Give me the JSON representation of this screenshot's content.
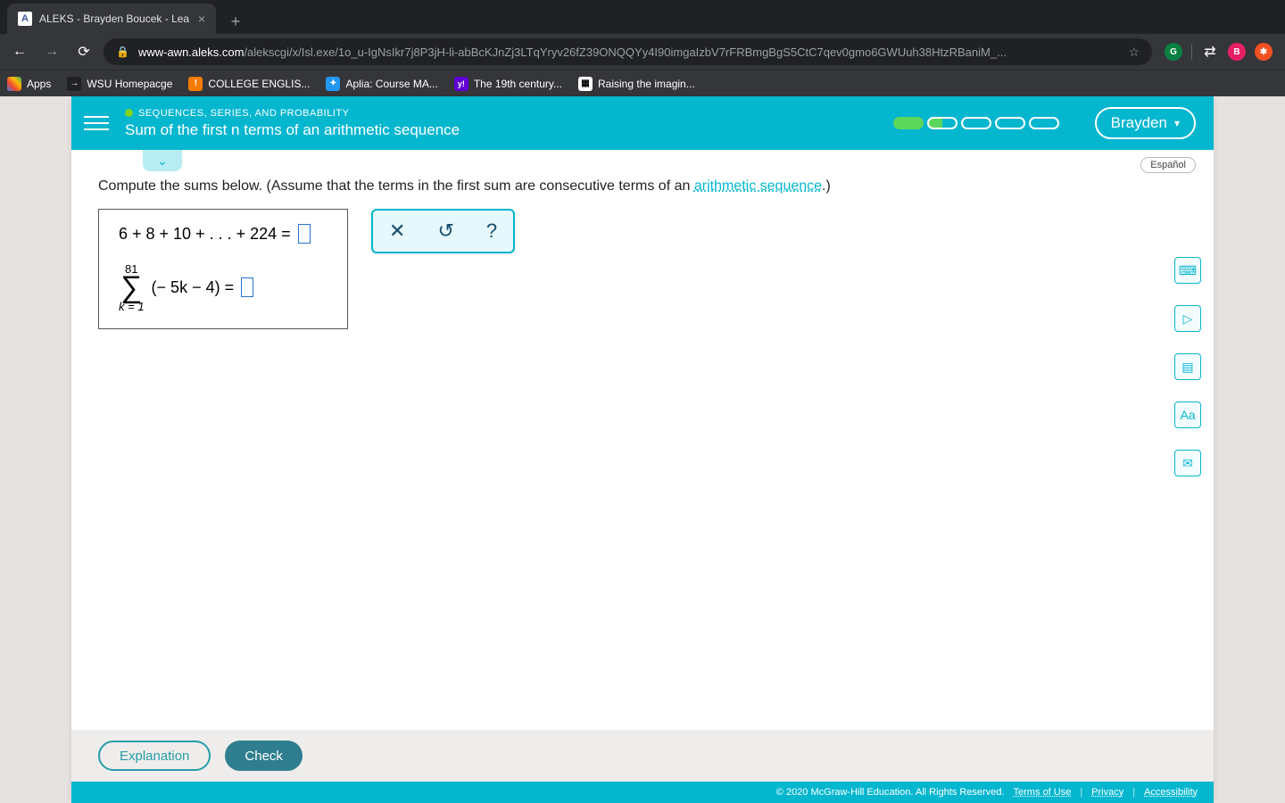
{
  "browser": {
    "tab_title": "ALEKS - Brayden Boucek - Lea",
    "url_domain": "www-awn.aleks.com",
    "url_path": "/alekscgi/x/Isl.exe/1o_u-IgNsIkr7j8P3jH-li-abBcKJnZj3LTqYryv26fZ39ONQQYy4I90imgaIzbV7rFRBmgBgS5CtC7qev0gmo6GWUuh38HtzRBaniM_...",
    "bookmarks": {
      "apps": "Apps",
      "wsu": "WSU Homepacge",
      "college": "COLLEGE ENGLIS...",
      "aplia": "Aplia: Course MA...",
      "century": "The 19th century...",
      "raising": "Raising the imagin..."
    },
    "profile_letter": "B"
  },
  "header": {
    "breadcrumb": "SEQUENCES, SERIES, AND PROBABILITY",
    "lesson_title": "Sum of the first n terms of an arithmetic sequence",
    "user_name": "Brayden"
  },
  "language_label": "Español",
  "prompt": {
    "before": "Compute the sums below. (Assume that the terms in the first sum are consecutive terms of an ",
    "link": "arithmetic sequence",
    "after": ".)"
  },
  "question": {
    "line1": "6 + 8 + 10 + . . . + 224  =",
    "sigma_upper": "81",
    "sigma_lower": "k = 1",
    "sigma_expr": "(− 5k − 4)  ="
  },
  "buttons": {
    "explanation": "Explanation",
    "check": "Check"
  },
  "side_tools": {
    "calc": "⌨",
    "play": "▷",
    "book": "▤",
    "aa": "Aa",
    "mail": "✉"
  },
  "footer": {
    "copyright": "© 2020 McGraw-Hill Education. All Rights Reserved.",
    "terms": "Terms of Use",
    "privacy": "Privacy",
    "accessibility": "Accessibility"
  }
}
